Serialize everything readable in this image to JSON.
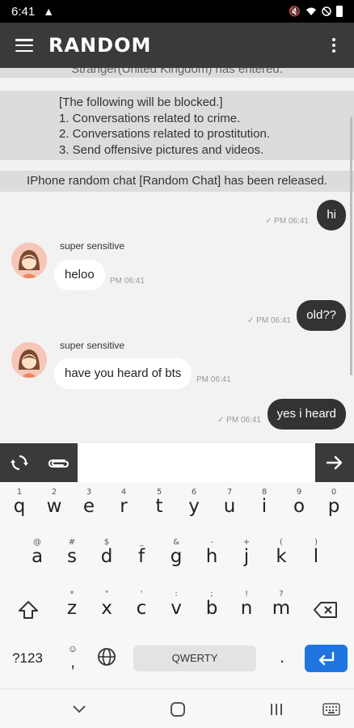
{
  "status_bar": {
    "time": "6:41",
    "icons": [
      "warning-icon",
      "mute-icon",
      "wifi-icon",
      "do-not-disturb-icon",
      "battery-icon"
    ]
  },
  "app_bar": {
    "title": "RANDOM",
    "menu_icon": "hamburger-menu-icon",
    "overflow_icon": "more-vert-icon"
  },
  "chat": {
    "system_partial": "Stranger(United Kingdom) has entered.",
    "rules": [
      "[The following will be blocked.]",
      "1. Conversations related to crime.",
      "2. Conversations related to prostitution.",
      "3. Send offensive pictures and videos."
    ],
    "announcement": "IPhone random chat [Random Chat] has been released.",
    "messages": [
      {
        "direction": "out",
        "text": "hi",
        "time": "PM 06:41"
      },
      {
        "direction": "in",
        "sender": "super sensitive",
        "text": "heloo",
        "time": "PM 06:41"
      },
      {
        "direction": "out",
        "text": "old??",
        "time": "PM 06:41"
      },
      {
        "direction": "in",
        "sender": "super sensitive",
        "text": "have you heard of bts",
        "time": "PM 06:41"
      },
      {
        "direction": "out",
        "text": "yes i heard",
        "time": "PM 06:41"
      }
    ]
  },
  "input_bar": {
    "value": "",
    "placeholder": "",
    "refresh_icon": "refresh-icon",
    "attach_icon": "paperclip-icon",
    "send_icon": "arrow-right-icon"
  },
  "keyboard": {
    "row1": [
      {
        "key": "q",
        "hint": "1"
      },
      {
        "key": "w",
        "hint": "2"
      },
      {
        "key": "e",
        "hint": "3"
      },
      {
        "key": "r",
        "hint": "4"
      },
      {
        "key": "t",
        "hint": "5"
      },
      {
        "key": "y",
        "hint": "6"
      },
      {
        "key": "u",
        "hint": "7"
      },
      {
        "key": "i",
        "hint": "8"
      },
      {
        "key": "o",
        "hint": "9"
      },
      {
        "key": "p",
        "hint": "0"
      }
    ],
    "row2": [
      {
        "key": "a",
        "hint": "@"
      },
      {
        "key": "s",
        "hint": "#"
      },
      {
        "key": "d",
        "hint": "$"
      },
      {
        "key": "f",
        "hint": "_"
      },
      {
        "key": "g",
        "hint": "&"
      },
      {
        "key": "h",
        "hint": "-"
      },
      {
        "key": "j",
        "hint": "+"
      },
      {
        "key": "k",
        "hint": "("
      },
      {
        "key": "l",
        "hint": ")"
      }
    ],
    "row3": [
      {
        "key": "z",
        "hint": "*"
      },
      {
        "key": "x",
        "hint": "\""
      },
      {
        "key": "c",
        "hint": "'"
      },
      {
        "key": "v",
        "hint": ":"
      },
      {
        "key": "b",
        "hint": ";"
      },
      {
        "key": "n",
        "hint": "!"
      },
      {
        "key": "m",
        "hint": "?"
      }
    ],
    "symbols_label": "?123",
    "space_label": "QWERTY",
    "period_label": ".",
    "comma_label": ",",
    "accent_color": "#1e75e0"
  },
  "nav_bar": {
    "icons": [
      "chevron-down-icon",
      "home-icon",
      "recents-icon",
      "keyboard-icon"
    ]
  },
  "colors": {
    "app_bar": "#3a3a3a",
    "chat_background": "#f2f2f2",
    "system_message_background": "#dcdcdc",
    "outgoing_bubble": "#333333",
    "incoming_bubble": "#ffffff"
  }
}
